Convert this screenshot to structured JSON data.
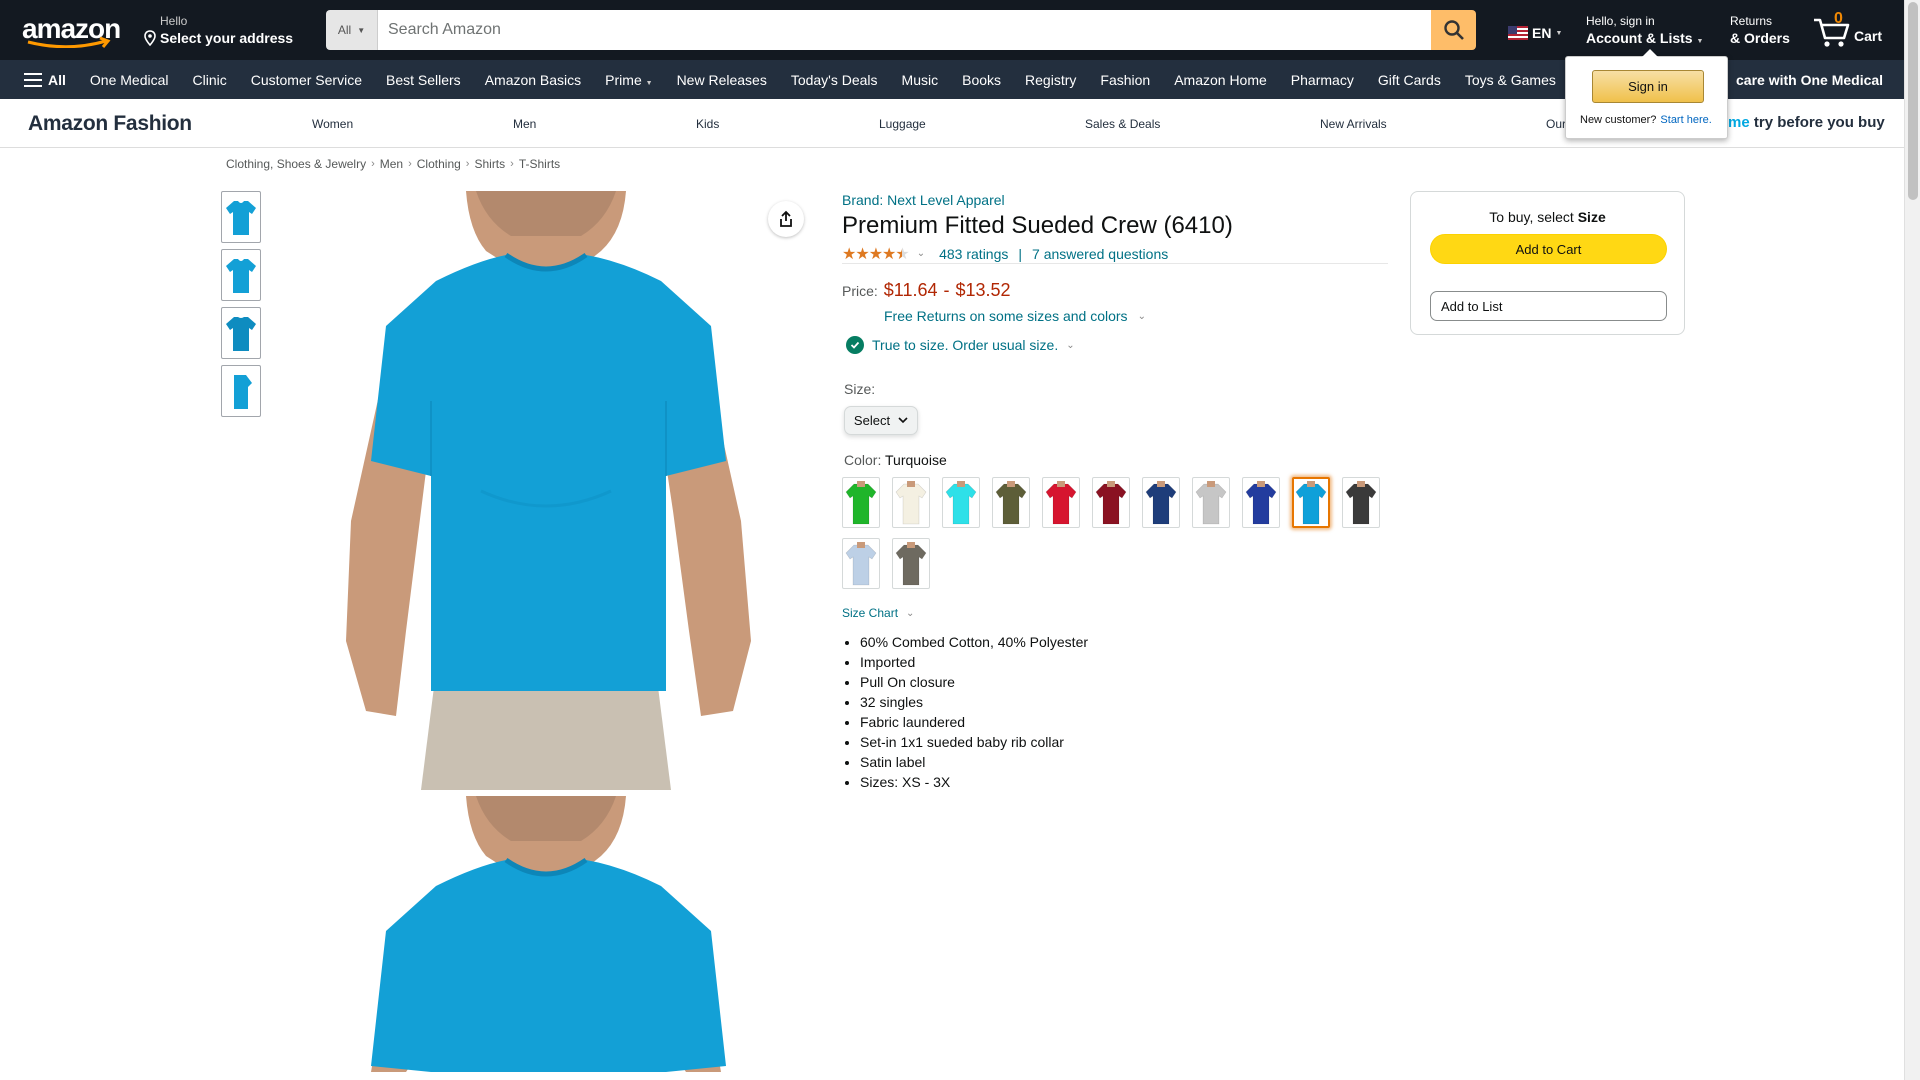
{
  "header": {
    "deliver_line1": "Hello",
    "deliver_line2": "Select your address",
    "search_category": "All",
    "search_placeholder": "Search Amazon",
    "language": "EN",
    "account_line1": "Hello, sign in",
    "account_line2": "Account & Lists",
    "returns_line1": "Returns",
    "returns_line2": "& Orders",
    "cart_count": "0",
    "cart_label": "Cart"
  },
  "nav": {
    "all_label": "All",
    "items": [
      "One Medical",
      "Clinic",
      "Customer Service",
      "Best Sellers",
      "Amazon Basics",
      "Prime",
      "New Releases",
      "Today's Deals",
      "Music",
      "Books",
      "Registry",
      "Fashion",
      "Amazon Home",
      "Pharmacy",
      "Gift Cards",
      "Toys & Games"
    ],
    "promo": "care with One Medical"
  },
  "subnav": {
    "brand": "Amazon Fashion",
    "links": [
      "Women",
      "Men",
      "Kids",
      "Luggage",
      "Sales & Deals",
      "New Arrivals",
      "Our"
    ],
    "promo_blue": "me",
    "promo_rest": "try before you buy"
  },
  "flyout": {
    "signin_label": "Sign in",
    "new_customer": "New customer?",
    "start_here": "Start here."
  },
  "breadcrumb": [
    "Clothing, Shoes & Jewelry",
    "Men",
    "Clothing",
    "Shirts",
    "T-Shirts"
  ],
  "product": {
    "brand": "Brand: Next Level Apparel",
    "title": "Premium Fitted Sueded Crew (6410)",
    "rating": 4.5,
    "ratings_count": "483 ratings",
    "answered": "7 answered questions",
    "price_label": "Price:",
    "price_low": "$11.64",
    "price_dash": "-",
    "price_high": "$13.52",
    "returns": "Free Returns on some sizes and colors",
    "fit": "True to size. Order usual size.",
    "size_label": "Size:",
    "size_select": "Select",
    "color_label": "Color:",
    "color_value": "Turquoise",
    "size_chart": "Size Chart",
    "bullets": [
      "60% Combed Cotton, 40% Polyester",
      "Imported",
      "Pull On closure",
      "32 singles",
      "Fabric laundered",
      "Set-in 1x1 sueded baby rib collar",
      "Satin label",
      "Sizes: XS - 3X"
    ]
  },
  "swatches": [
    {
      "color": "#1fb52a"
    },
    {
      "color": "#f4f0e2"
    },
    {
      "color": "#2ee0e8"
    },
    {
      "color": "#5d5e38"
    },
    {
      "color": "#d6152f"
    },
    {
      "color": "#8a1222"
    },
    {
      "color": "#1e3d7a"
    },
    {
      "color": "#c6c6c6"
    },
    {
      "color": "#233c9e"
    },
    {
      "color": "#0fa0d9",
      "selected": true
    },
    {
      "color": "#3a3a3a"
    },
    {
      "color": "#bdd0e6"
    },
    {
      "color": "#6e6a60"
    }
  ],
  "buybox": {
    "prompt": "To buy, select",
    "prompt_bold": "Size",
    "add_to_cart": "Add to Cart",
    "add_to_list": "Add to List"
  },
  "colors": {
    "shirt": "#13a0d6",
    "header_bg": "#131921",
    "nav_bg": "#232f3e"
  }
}
